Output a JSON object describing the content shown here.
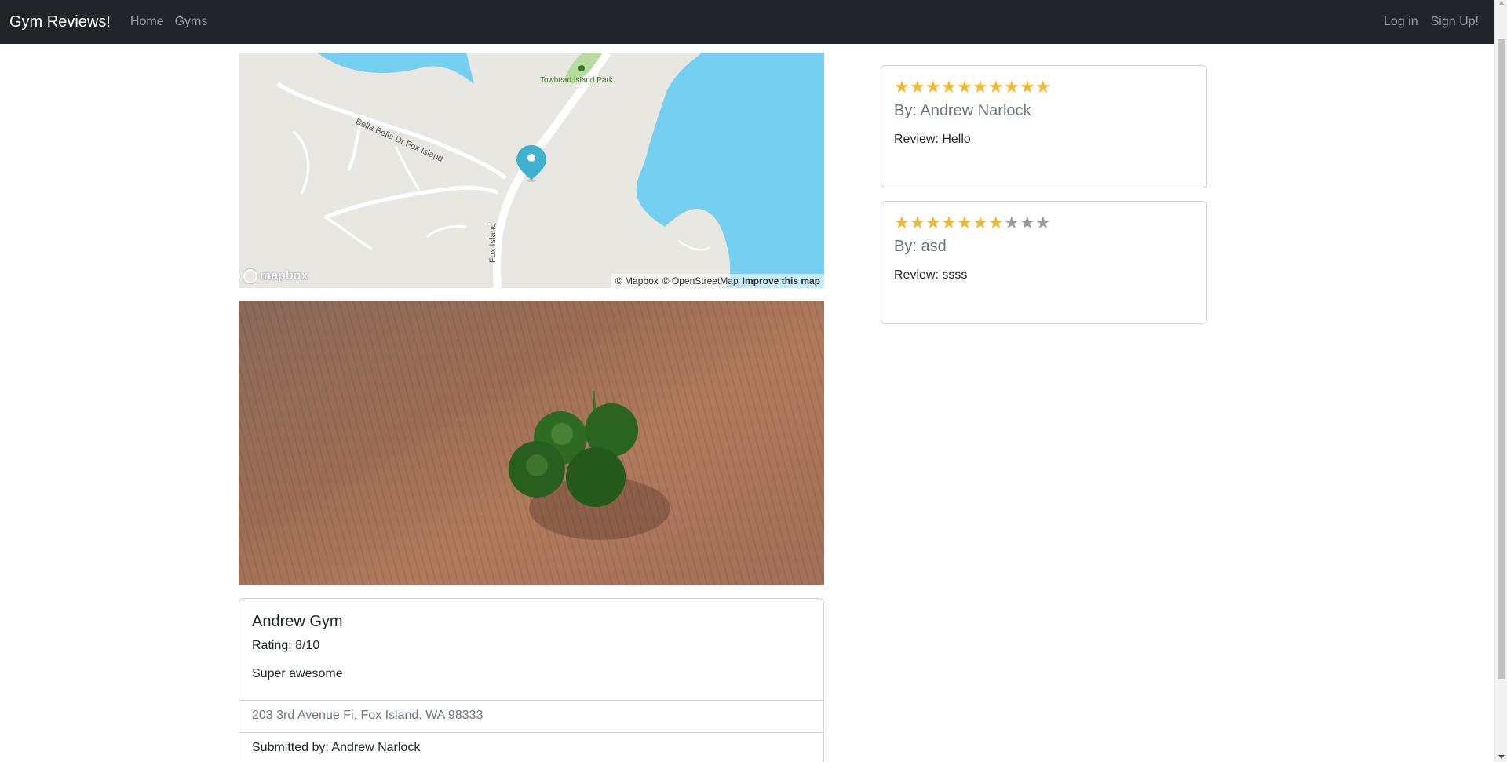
{
  "navbar": {
    "brand": "Gym Reviews!",
    "links": {
      "home": "Home",
      "gyms": "Gyms"
    },
    "auth": {
      "login": "Log in",
      "signup": "Sign Up!"
    }
  },
  "map": {
    "labels": {
      "park": "Towhead Island Park",
      "street": "Bella Bella Dr Fox Island",
      "road": "Fox Island"
    },
    "logo": "mapbox",
    "attribution": {
      "mapbox": "© Mapbox",
      "osm": "© OpenStreetMap",
      "improve": "Improve this map"
    },
    "colors": {
      "water": "#75cff0",
      "land": "#e9e7e2",
      "road": "#ffffff",
      "marker": "#3fb1ce"
    }
  },
  "gym": {
    "title": "Andrew Gym",
    "rating": "Rating: 8/10",
    "description": "Super awesome",
    "address": "203 3rd Avenue Fi, Fox Island, WA 98333",
    "submitted_by": "Submitted by: Andrew Narlock"
  },
  "reviews": [
    {
      "stars_filled": 10,
      "stars_total": 10,
      "author": "By: Andrew Narlock",
      "text": "Review: Hello"
    },
    {
      "stars_filled": 7,
      "stars_total": 10,
      "author": "By: asd",
      "text": "Review: ssss"
    }
  ],
  "colors": {
    "navbar": "#212529",
    "star_on": "#f0b82f",
    "star_off": "#9a9a9a"
  }
}
